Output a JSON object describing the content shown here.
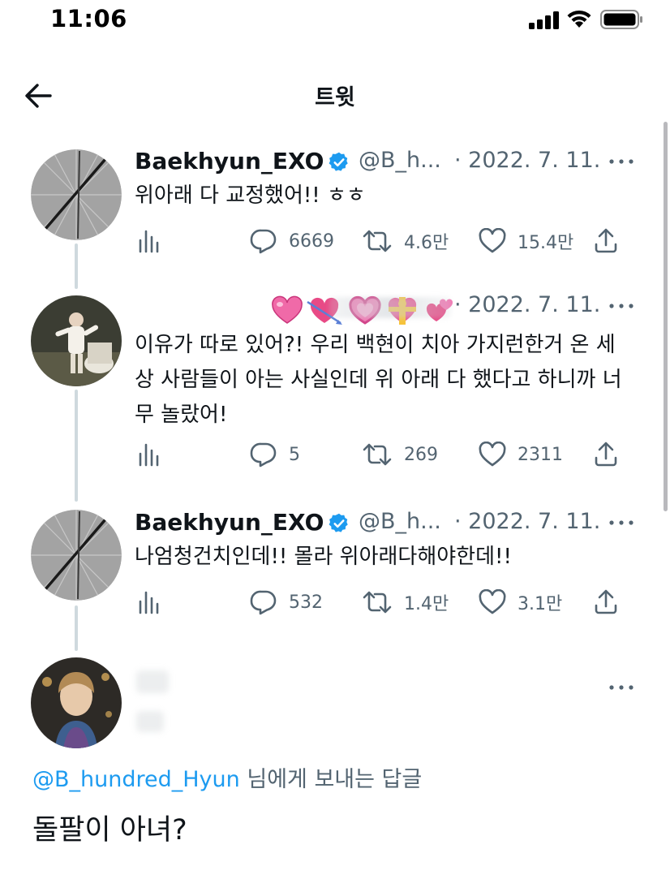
{
  "status_bar": {
    "time": "11:06"
  },
  "header": {
    "title": "트윗"
  },
  "tweets": [
    {
      "name": "Baekhyun_EXO",
      "handle": "@B_h...",
      "date": "· 2022. 7. 11.",
      "text": "위아래 다 교정했어!! ㅎㅎ",
      "replies": "6669",
      "retweets": "4.6만",
      "likes": "15.4만"
    },
    {
      "name_emojis": [
        "pink-heart",
        "heart-with-arrow",
        "growing-heart",
        "heart-with-ribbon",
        "revolving-hearts"
      ],
      "date": "· 2022. 7. 11.",
      "text": "이유가 따로 있어?! 우리 백현이 치아 가지런한거 온 세상 사람들이 아는 사실인데 위 아래 다 했다고 하니까 너무 놀랐어!",
      "replies": "5",
      "retweets": "269",
      "likes": "2311"
    },
    {
      "name": "Baekhyun_EXO",
      "handle": "@B_h...",
      "date": "· 2022. 7. 11.",
      "text": "나엄청건치인데!! 몰라 위아래다해야한데!!",
      "replies": "532",
      "retweets": "1.4만",
      "likes": "3.1만"
    }
  ],
  "compose": {
    "reply_to_mention": "@B_hundred_Hyun",
    "reply_to_suffix": " 님에게 보내는 답글",
    "input_text": "돌팔이 아녀?"
  },
  "colors": {
    "text": "#0f1419",
    "secondary": "#536471",
    "verified": "#1d9bf0",
    "thread_line": "#cfd9de"
  }
}
